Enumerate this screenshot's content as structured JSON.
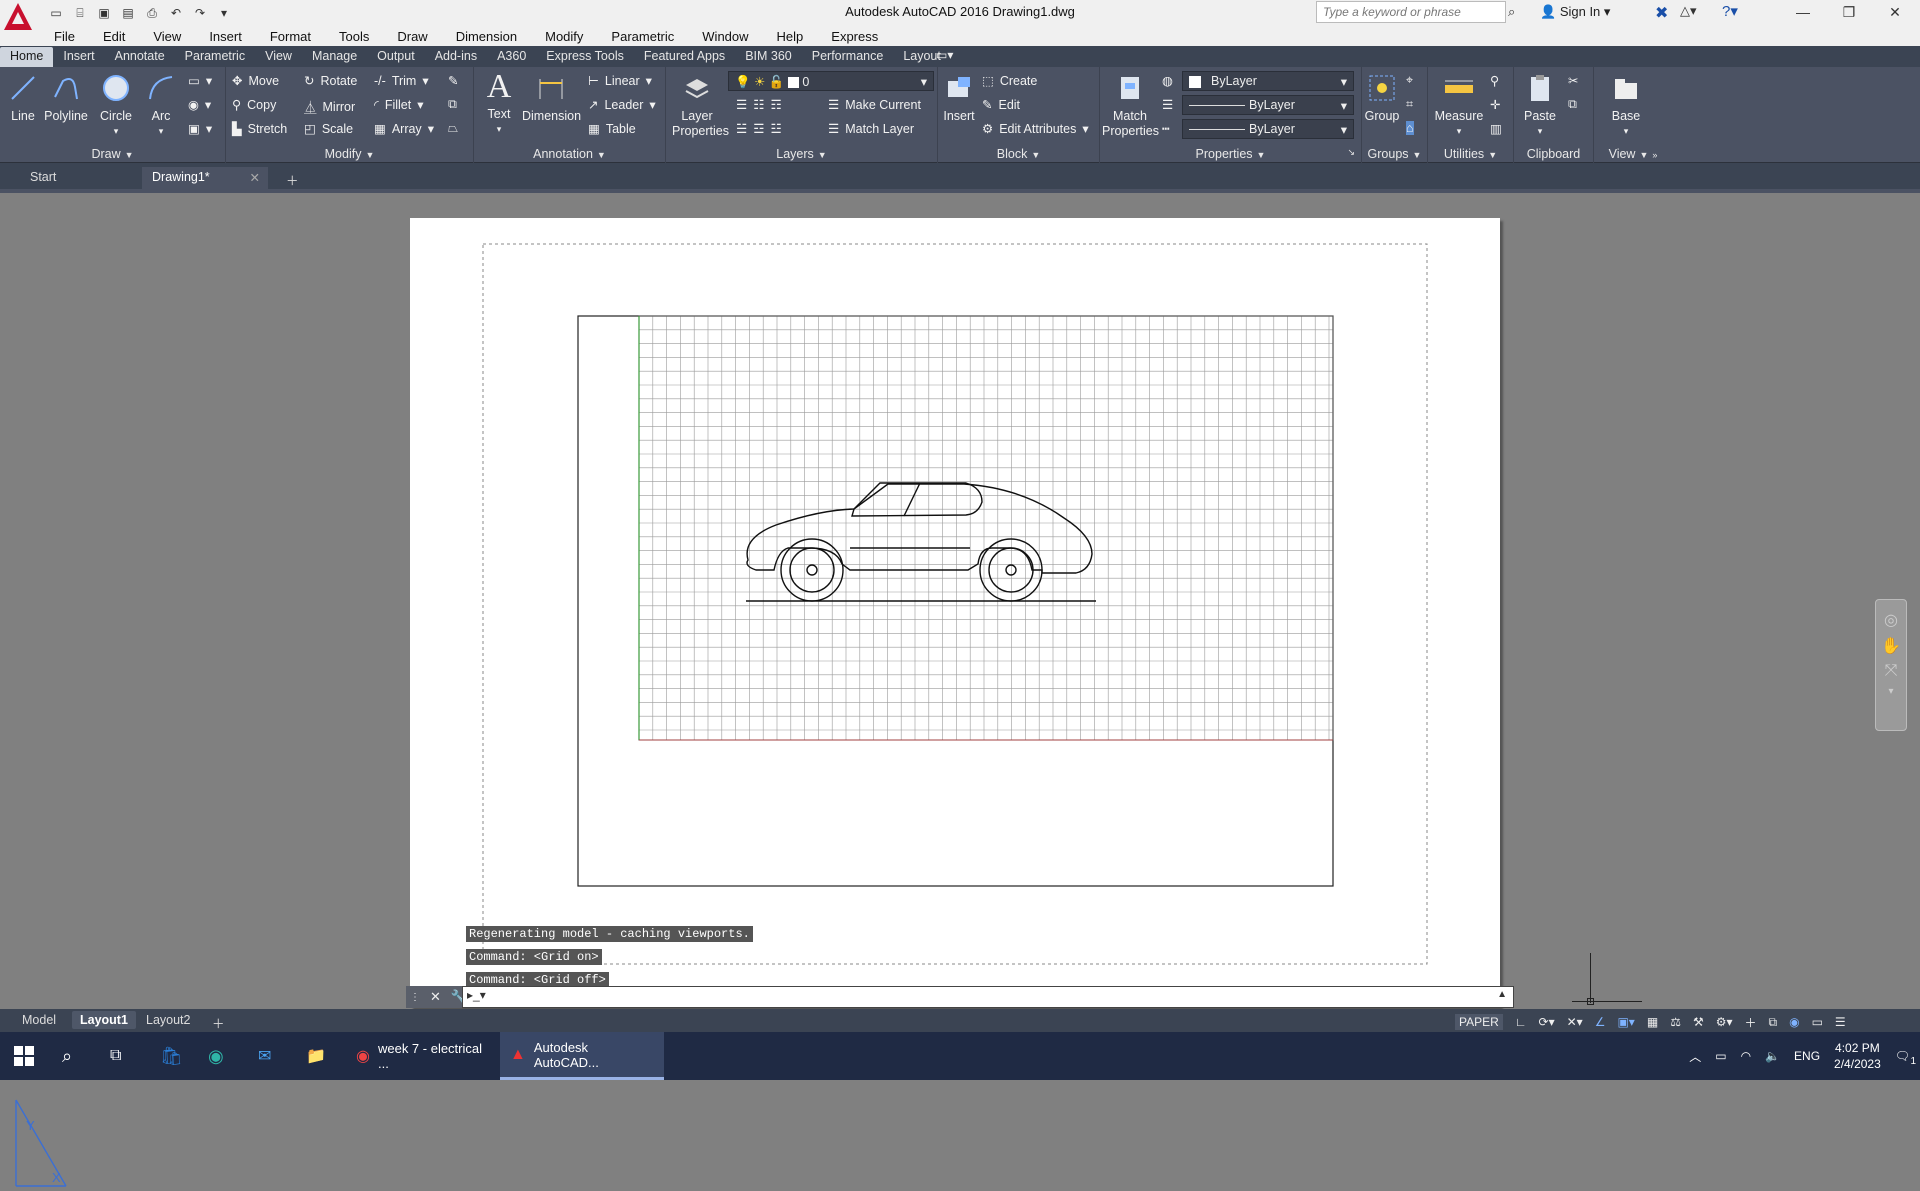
{
  "app": {
    "title": "Autodesk AutoCAD 2016    Drawing1.dwg",
    "search_placeholder": "Type a keyword or phrase",
    "sign_in": "Sign In"
  },
  "menu": [
    "File",
    "Edit",
    "View",
    "Insert",
    "Format",
    "Tools",
    "Draw",
    "Dimension",
    "Modify",
    "Parametric",
    "Window",
    "Help",
    "Express"
  ],
  "ribbon_tabs": [
    "Home",
    "Insert",
    "Annotate",
    "Parametric",
    "View",
    "Manage",
    "Output",
    "Add-ins",
    "A360",
    "Express Tools",
    "Featured Apps",
    "BIM 360",
    "Performance",
    "Layout"
  ],
  "active_ribbon_tab": "Home",
  "draw": {
    "title": "Draw",
    "line": "Line",
    "polyline": "Polyline",
    "circle": "Circle",
    "arc": "Arc"
  },
  "modify": {
    "title": "Modify",
    "move": "Move",
    "rotate": "Rotate",
    "trim": "Trim",
    "copy": "Copy",
    "mirror": "Mirror",
    "fillet": "Fillet",
    "stretch": "Stretch",
    "scale": "Scale",
    "array": "Array"
  },
  "annotation": {
    "title": "Annotation",
    "text": "Text",
    "dimension": "Dimension",
    "linear": "Linear",
    "leader": "Leader",
    "table": "Table"
  },
  "layers": {
    "title": "Layers",
    "layer_properties": "Layer Properties",
    "current_layer": "0",
    "make_current": "Make Current",
    "match_layer": "Match Layer"
  },
  "block": {
    "title": "Block",
    "insert": "Insert",
    "create": "Create",
    "edit": "Edit",
    "edit_attributes": "Edit Attributes"
  },
  "properties": {
    "title": "Properties",
    "match_properties": "Match Properties",
    "color": "ByLayer",
    "linetype": "ByLayer",
    "lineweight": "ByLayer"
  },
  "groups": {
    "title": "Groups",
    "group": "Group"
  },
  "utilities": {
    "title": "Utilities",
    "measure": "Measure"
  },
  "clipboard": {
    "title": "Clipboard",
    "paste": "Paste"
  },
  "view_panel": {
    "title": "View",
    "base": "Base"
  },
  "doc_tabs": {
    "start": "Start",
    "drawing": "Drawing1*"
  },
  "command_history": [
    "Regenerating model - caching viewports.",
    "Command:  <Grid on>",
    "Command:  <Grid off>"
  ],
  "layout_tabs": {
    "model": "Model",
    "layout1": "Layout1",
    "layout2": "Layout2"
  },
  "status": {
    "paper": "PAPER"
  },
  "taskbar": {
    "chrome": "week 7 - electrical ...",
    "autocad": "Autodesk AutoCAD...",
    "lang": "ENG",
    "time": "4:02 PM",
    "date": "2/4/2023",
    "notifications": "1"
  },
  "colors": {
    "ribbon_bg": "#4b5263",
    "tab_bg": "#3b4453",
    "taskbar": "#1f2a44",
    "grid": "#9a9a9a"
  }
}
